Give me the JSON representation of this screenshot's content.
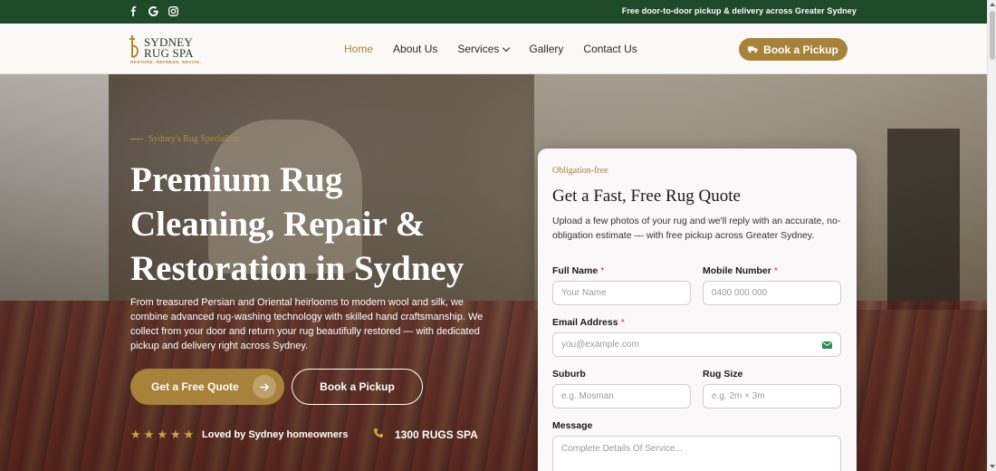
{
  "topbar": {
    "socials": [
      "facebook-icon",
      "google-icon",
      "instagram-icon"
    ],
    "promo": "Free door-to-door pickup & delivery across Greater Sydney"
  },
  "logo": {
    "line1": "SYDNEY",
    "line2": "RUG SPA",
    "tagline": "RESTORE. REFRESH. REVIVE."
  },
  "nav": {
    "items": [
      {
        "label": "Home",
        "active": true
      },
      {
        "label": "About Us",
        "active": false
      },
      {
        "label": "Services",
        "active": false
      },
      {
        "label": "Gallery",
        "active": false
      },
      {
        "label": "Contact Us",
        "active": false
      }
    ],
    "cta": "Book a Pickup"
  },
  "hero": {
    "kicker": "Sydney's Rug Specialists",
    "title_lines": [
      "Premium Rug",
      "Cleaning, Repair &",
      "Restoration in Sydney"
    ],
    "description": "From treasured Persian and Oriental heirlooms to modern wool and silk, we combine advanced rug-washing technology with skilled hand craftsmanship. We collect from your door and return your rug beautifully restored — with dedicated pickup and delivery right across Sydney.",
    "primary_button": "Get a Free Quote",
    "secondary_button": "Book a Pickup",
    "rating_stars": 5,
    "rating_text": "Loved by Sydney homeowners",
    "phone": "1300 RUGS SPA"
  },
  "quote_form": {
    "eyebrow": "Obligation-free",
    "title": "Get a Fast, Free Rug Quote",
    "subtitle": "Upload a few photos of your rug and we'll reply with an accurate, no-obligation estimate — with free pickup across Greater Sydney.",
    "fields": {
      "full_name": {
        "label": "Full Name",
        "required": "*",
        "placeholder": "Your Name"
      },
      "mobile": {
        "label": "Mobile Number",
        "required": "*",
        "placeholder": "0400 000 000"
      },
      "email": {
        "label": "Email Address",
        "required": "*",
        "placeholder": "you@example.com"
      },
      "suburb": {
        "label": "Suburb",
        "placeholder": "e.g. Mosman"
      },
      "rug_size": {
        "label": "Rug Size",
        "placeholder": "e.g. 2m × 3m"
      },
      "message": {
        "label": "Message",
        "placeholder": "Complete Details Of Service..."
      }
    }
  },
  "colors": {
    "topbar": "#1e4a2a",
    "accent_gold": "#a8823a",
    "header_bg": "#fbf9f5",
    "required_red": "#c0392b"
  }
}
